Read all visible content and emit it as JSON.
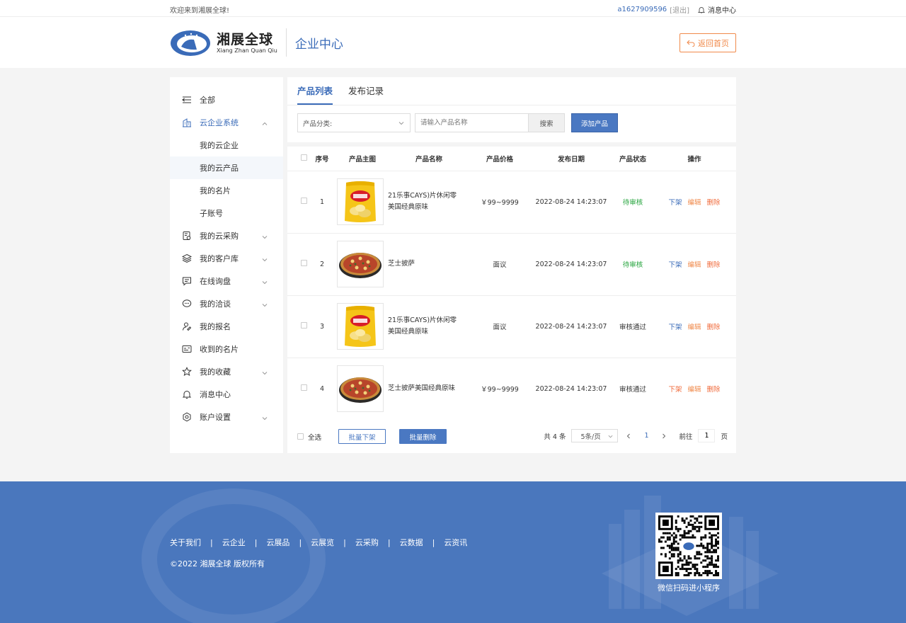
{
  "topbar": {
    "welcome": "欢迎来到湘展全球!",
    "username": "a1627909596",
    "logout": "[退出]",
    "messages": "消息中心"
  },
  "header": {
    "logo_title": "湘展全球",
    "logo_sub": "Xiang Zhan Quan Qiu",
    "center_title": "企业中心",
    "back_button": "返回首页"
  },
  "sidebar": {
    "items": [
      {
        "label": "全部",
        "icon": "list-icon",
        "has_chevron": false
      },
      {
        "label": "云企业系统",
        "icon": "building-icon",
        "has_chevron": true,
        "expanded": true,
        "children": [
          "我的云企业",
          "我的云产品",
          "我的名片",
          "子账号"
        ],
        "selected_child": "我的云产品"
      },
      {
        "label": "我的云采购",
        "icon": "procurement-icon",
        "has_chevron": true
      },
      {
        "label": "我的客户库",
        "icon": "layers-icon",
        "has_chevron": true
      },
      {
        "label": "在线询盘",
        "icon": "inquiry-icon",
        "has_chevron": true
      },
      {
        "label": "我的洽谈",
        "icon": "chat-icon",
        "has_chevron": true
      },
      {
        "label": "我的报名",
        "icon": "user-edit-icon",
        "has_chevron": false
      },
      {
        "label": "收到的名片",
        "icon": "card-icon",
        "has_chevron": false
      },
      {
        "label": "我的收藏",
        "icon": "star-icon",
        "has_chevron": true
      },
      {
        "label": "消息中心",
        "icon": "bell-icon",
        "has_chevron": false
      },
      {
        "label": "账户设置",
        "icon": "settings-icon",
        "has_chevron": true
      }
    ]
  },
  "tabs": [
    {
      "label": "产品列表",
      "active": true
    },
    {
      "label": "发布记录",
      "active": false
    }
  ],
  "filters": {
    "category_label": "产品分类:",
    "search_placeholder": "请输入产品名称",
    "search_button": "搜索",
    "add_button": "添加产品"
  },
  "table": {
    "headers": [
      "序号",
      "产品主图",
      "产品名称",
      "产品价格",
      "发布日期",
      "产品状态",
      "操作"
    ],
    "rows": [
      {
        "no": "1",
        "image": "chips",
        "name_line1": "21乐事CAYS)片休闲零",
        "name_line2": "美国经典原味",
        "price": "￥99~9999",
        "date": "2022-08-24 14:23:07",
        "status": "待审核",
        "status_type": "pending",
        "op1": "下架",
        "op1_color": "blue",
        "op2": "编辑",
        "op3": "删除"
      },
      {
        "no": "2",
        "image": "pizza",
        "name_line1": "芝士披萨",
        "name_line2": "",
        "price": "面议",
        "date": "2022-08-24 14:23:07",
        "status": "待审核",
        "status_type": "pending",
        "op1": "下架",
        "op1_color": "blue",
        "op2": "编辑",
        "op3": "删除"
      },
      {
        "no": "3",
        "image": "chips",
        "name_line1": "21乐事CAYS)片休闲零",
        "name_line2": "美国经典原味",
        "price": "面议",
        "date": "2022-08-24 14:23:07",
        "status": "审核通过",
        "status_type": "pass",
        "op1": "下架",
        "op1_color": "blue",
        "op2": "编辑",
        "op3": "删除"
      },
      {
        "no": "4",
        "image": "pizza",
        "name_line1": "芝士披萨美国经典原味",
        "name_line2": "",
        "price": "￥99~9999",
        "date": "2022-08-24 14:23:07",
        "status": "审核通过",
        "status_type": "pass",
        "op1": "下架",
        "op1_color": "orange",
        "op2": "编辑",
        "op3": "删除"
      }
    ]
  },
  "table_foot": {
    "select_all": "全选",
    "batch_off": "批量下架",
    "batch_delete": "批量删除",
    "total": "共 4 条",
    "page_size": "5条/页",
    "current_page": "1",
    "goto_label": "前往",
    "goto_value": "1",
    "page_suffix": "页"
  },
  "footer": {
    "links": [
      "关于我们",
      "云企业",
      "云展品",
      "云展览",
      "云采购",
      "云数据",
      "云资讯"
    ],
    "copyright": "©2022 湘展全球 版权所有",
    "qr_caption": "微信扫码进小程序"
  },
  "colors": {
    "primary": "#3a6bb8",
    "accent_orange": "#f08a4b",
    "status_pending": "#22a33a",
    "footer_bg": "#4a77bd"
  }
}
